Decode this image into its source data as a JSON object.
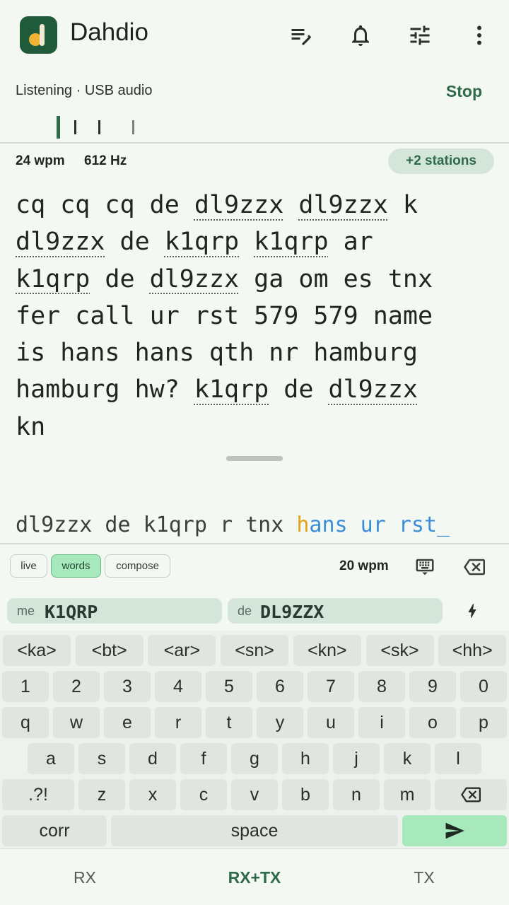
{
  "app": {
    "title": "Dahdio"
  },
  "toolbar_icons": [
    "edit-list-icon",
    "bell-icon",
    "sliders-icon",
    "more-vert-icon"
  ],
  "status": {
    "text": "Listening · USB audio",
    "stop_label": "Stop"
  },
  "info": {
    "wpm": "24 wpm",
    "freq": "612 Hz",
    "stations": "+2 stations"
  },
  "rx_lines": [
    [
      [
        "cq cq cq de ",
        false
      ],
      [
        "dl9zzx",
        true
      ],
      [
        " ",
        false
      ],
      [
        "dl9zzx",
        true
      ],
      [
        " k",
        false
      ]
    ],
    [
      [
        "dl9zzx",
        true
      ],
      [
        " de ",
        false
      ],
      [
        "k1qrp",
        true
      ],
      [
        " ",
        false
      ],
      [
        "k1qrp",
        true
      ],
      [
        " ar",
        false
      ]
    ],
    [
      [
        "k1qrp",
        true
      ],
      [
        " de ",
        false
      ],
      [
        "dl9zzx",
        true
      ],
      [
        " ga om es tnx",
        false
      ]
    ],
    [
      [
        "fer call ur rst 579 579 name",
        false
      ]
    ],
    [
      [
        "is hans hans qth nr hamburg",
        false
      ]
    ],
    [
      [
        "hamburg hw? ",
        false
      ],
      [
        "k1qrp",
        true
      ],
      [
        " de ",
        false
      ],
      [
        "dl9zzx",
        true
      ]
    ],
    [
      [
        "kn",
        false
      ]
    ]
  ],
  "tx": {
    "sent": "dl9zzx de k1qrp r tnx ",
    "pending_first": "h",
    "pending_rest": "ans ur rst",
    "cursor": "_"
  },
  "modes": {
    "live": "live",
    "words": "words",
    "compose": "compose",
    "active": "words"
  },
  "tx_wpm": "20 wpm",
  "calls": {
    "me_label": "me",
    "me_value": "K1QRP",
    "de_label": "de",
    "de_value": "DL9ZZX"
  },
  "keyboard": {
    "prosigns": [
      "<ka>",
      "<bt>",
      "<ar>",
      "<sn>",
      "<kn>",
      "<sk>",
      "<hh>"
    ],
    "digits": [
      "1",
      "2",
      "3",
      "4",
      "5",
      "6",
      "7",
      "8",
      "9",
      "0"
    ],
    "row1": [
      "q",
      "w",
      "e",
      "r",
      "t",
      "y",
      "u",
      "i",
      "o",
      "p"
    ],
    "row2": [
      "a",
      "s",
      "d",
      "f",
      "g",
      "h",
      "j",
      "k",
      "l"
    ],
    "row3_special": ".?!",
    "row3": [
      "z",
      "x",
      "c",
      "v",
      "b",
      "n",
      "m"
    ],
    "corr": "corr",
    "space": "space"
  },
  "nav": {
    "rx": "RX",
    "rxtx": "RX+TX",
    "tx": "TX",
    "active": "rxtx"
  },
  "colors": {
    "accent": "#2e6a4a",
    "chip_bg": "#d3e6d9",
    "send_key": "#a7e8bd",
    "pending_first": "#e3a21a",
    "pending": "#3a8ed8",
    "logo_bg": "#1f5a3a",
    "logo_mark": "#f0b232"
  }
}
